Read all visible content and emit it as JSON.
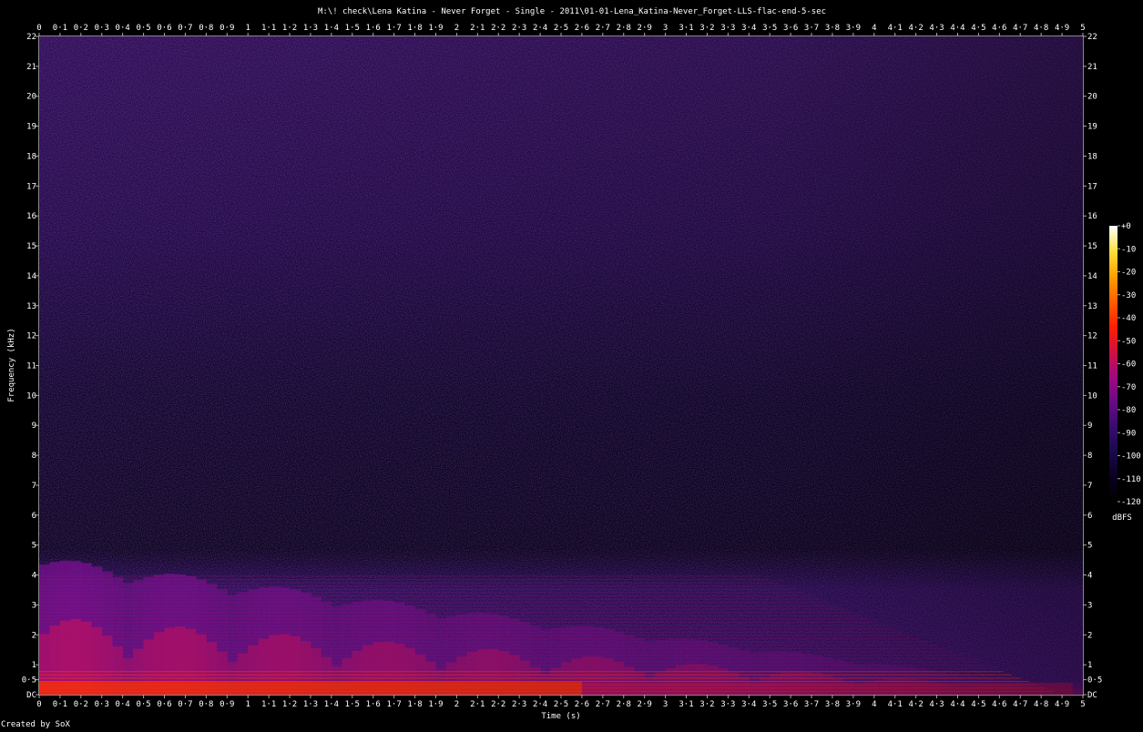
{
  "chart_data": {
    "type": "heatmap",
    "title": "M:\\! check\\Lena Katina - Never Forget - Single - 2011\\01-01-Lena_Katina-Never_Forget-LLS-flac-end-5-sec",
    "xlabel": "Time (s)",
    "ylabel": "Frequency (kHz)",
    "footer": "Created by SoX",
    "xlim": [
      0,
      5
    ],
    "ylim": [
      0,
      22
    ],
    "x_ticks": [
      "0",
      "0·1",
      "0·2",
      "0·3",
      "0·4",
      "0·5",
      "0·6",
      "0·7",
      "0·8",
      "0·9",
      "1",
      "1·1",
      "1·2",
      "1·3",
      "1·4",
      "1·5",
      "1·6",
      "1·7",
      "1·8",
      "1·9",
      "2",
      "2·1",
      "2·2",
      "2·3",
      "2·4",
      "2·5",
      "2·6",
      "2·7",
      "2·8",
      "2·9",
      "3",
      "3·1",
      "3·2",
      "3·3",
      "3·4",
      "3·5",
      "3·6",
      "3·7",
      "3·8",
      "3·9",
      "4",
      "4·1",
      "4·2",
      "4·3",
      "4·4",
      "4·5",
      "4·6",
      "4·7",
      "4·8",
      "4·9",
      "5"
    ],
    "y_ticks": [
      "DC",
      "0·5",
      "1",
      "2",
      "3",
      "4",
      "5",
      "6",
      "7",
      "8",
      "9",
      "10",
      "11",
      "12",
      "13",
      "14",
      "15",
      "16",
      "17",
      "18",
      "19",
      "20",
      "21",
      "22"
    ],
    "y_tick_values": [
      0,
      0.5,
      1,
      2,
      3,
      4,
      5,
      6,
      7,
      8,
      9,
      10,
      11,
      12,
      13,
      14,
      15,
      16,
      17,
      18,
      19,
      20,
      21,
      22
    ],
    "colorbar": {
      "label": "dBFS",
      "range": [
        -120,
        0
      ],
      "ticks": [
        "+0",
        "-10",
        "-20",
        "-30",
        "-40",
        "-50",
        "-60",
        "-70",
        "-80",
        "-90",
        "-100",
        "-110",
        "-120"
      ]
    },
    "colormap": [
      "#000000",
      "#0a0022",
      "#1a0a4a",
      "#3a0a70",
      "#6a0a88",
      "#a00a80",
      "#d01040",
      "#ff2000",
      "#ff6000",
      "#ffa000",
      "#ffe040",
      "#ffffff"
    ]
  }
}
